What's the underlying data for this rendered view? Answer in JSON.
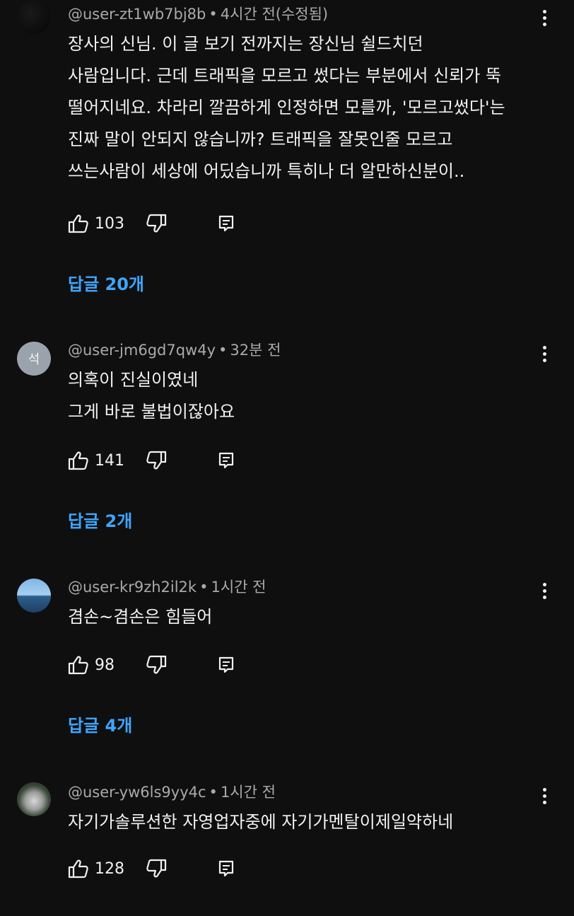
{
  "comments": [
    {
      "author": "@user-zt1wb7bj8b",
      "time": "4시간 전(수정됨)",
      "text": "장사의 신님. 이 글 보기 전까지는 장신님 쉴드치던\n사람입니다. 근데 트래픽을 모르고 썼다는 부분에서 신뢰가 뚝\n떨어지네요. 차라리 깔끔하게 인정하면 모를까, '모르고썼다'는\n진짜 말이 안되지 않습니까? 트래픽을 잘못인줄 모르고\n쓰는사람이 세상에 어딨습니까 특히나 더 알만하신분이..",
      "likes": "103",
      "replies": "답글 20개",
      "avatar_letter": ""
    },
    {
      "author": "@user-jm6gd7qw4y",
      "time": "32분 전",
      "text": "의혹이 진실이였네\n그게 바로 불법이잖아요",
      "likes": "141",
      "replies": "답글 2개",
      "avatar_letter": "석"
    },
    {
      "author": "@user-kr9zh2il2k",
      "time": "1시간 전",
      "text": "겸손~겸손은 힘들어",
      "likes": "98",
      "replies": "답글 4개",
      "avatar_letter": ""
    },
    {
      "author": "@user-yw6ls9yy4c",
      "time": "1시간 전",
      "text": "자기가솔루션한 자영업자중에 자기가멘탈이제일약하네",
      "likes": "128",
      "replies": "",
      "avatar_letter": ""
    }
  ],
  "separator": "•",
  "colors": {
    "background": "#0f0f0f",
    "text": "#f1f1f1",
    "meta": "#aaaaaa",
    "link": "#3ea6ff"
  },
  "icons": {
    "like": "thumb-up-icon",
    "dislike": "thumb-down-icon",
    "reply": "reply-icon",
    "more": "more-vert-icon"
  }
}
